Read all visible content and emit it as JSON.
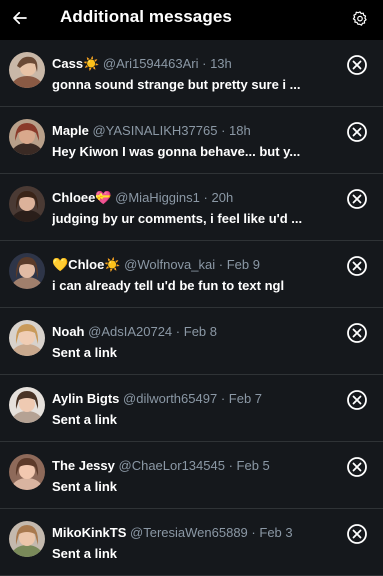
{
  "header": {
    "title": "Additional messages",
    "back_icon": "arrow-left-icon",
    "settings_icon": "gear-icon"
  },
  "colors": {
    "background": "#15181c",
    "header_bg": "#000000",
    "muted_text": "#8b98a5",
    "divider": "#2f3336"
  },
  "messages": [
    {
      "name": "Cass☀️",
      "handle": "@Ari1594463Ari",
      "time": "13h",
      "preview": "gonna sound strange but pretty sure i ..."
    },
    {
      "name": "Maple",
      "handle": "@YASINALIKH37765",
      "time": "18h",
      "preview": "Hey Kiwon I was gonna behave... but y..."
    },
    {
      "name": "Chloee💝",
      "handle": "@MiaHiggins1",
      "time": "20h",
      "preview": "judging by ur comments, i feel like u'd ..."
    },
    {
      "name": "💛Chloe☀️",
      "handle": "@Wolfnova_kai",
      "time": "Feb 9",
      "preview": "i can already tell u'd be fun to text ngl"
    },
    {
      "name": "Noah",
      "handle": "@AdsIA20724",
      "time": "Feb 8",
      "preview": "Sent a link"
    },
    {
      "name": "Aylin Bigts",
      "handle": "@dilworth65497",
      "time": "Feb 7",
      "preview": "Sent a link"
    },
    {
      "name": "The Jessy",
      "handle": "@ChaeLor134545",
      "time": "Feb 5",
      "preview": "Sent a link"
    },
    {
      "name": "MikoKinkTS",
      "handle": "@TeresiaWen65889",
      "time": "Feb 3",
      "preview": "Sent a link"
    }
  ]
}
